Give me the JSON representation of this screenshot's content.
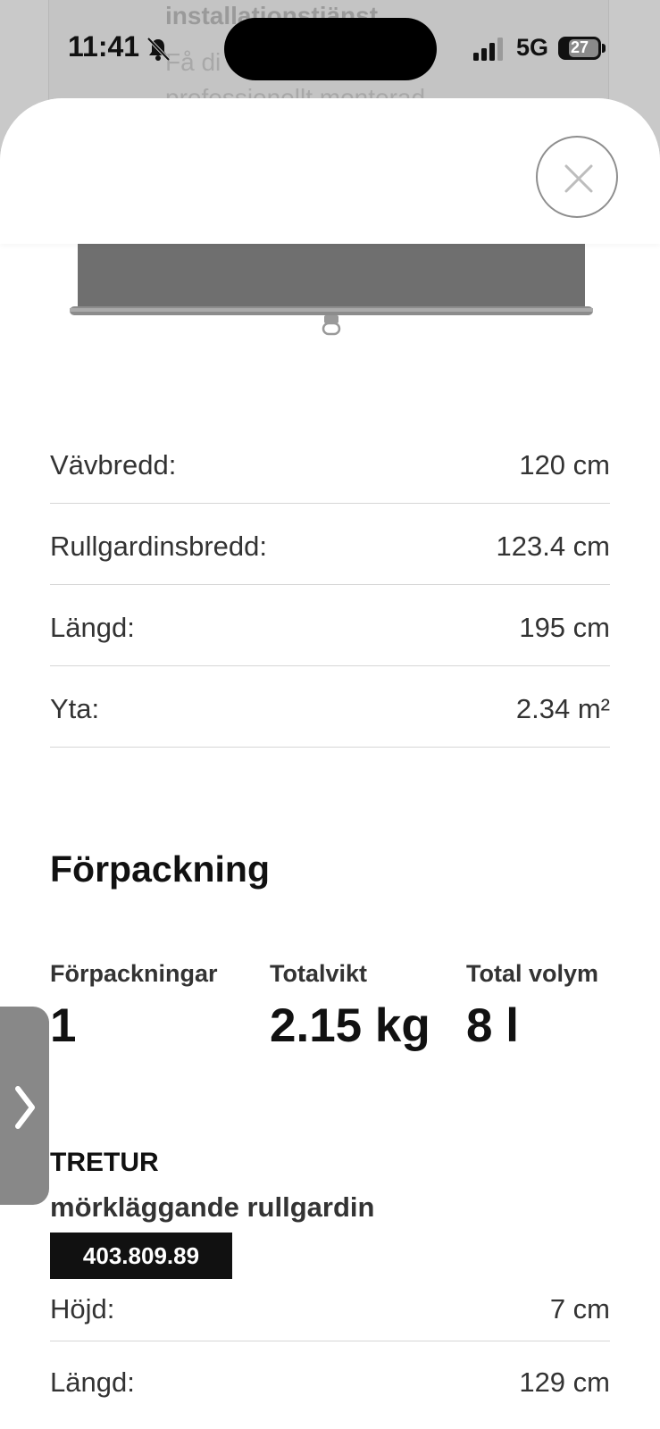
{
  "background_page": {
    "title_fragment": "installationstjänst",
    "line_fragment": "Få di",
    "line2_fragment": "professionellt monterad"
  },
  "status_bar": {
    "time": "11:41",
    "network": "5G",
    "battery": "27",
    "icons": [
      "bell-slash-icon",
      "signal-icon",
      "battery-icon"
    ]
  },
  "sheet": {
    "close_icon": "close-icon",
    "measurements": [
      {
        "label": "Vävbredd:",
        "value": "120 cm"
      },
      {
        "label": "Rullgardinsbredd:",
        "value": "123.4 cm"
      },
      {
        "label": "Längd:",
        "value": "195 cm"
      },
      {
        "label": "Yta:",
        "value": "2.34 m²"
      }
    ],
    "packaging": {
      "title": "Förpackning",
      "packages_label": "Förpackningar",
      "packages_value": "1",
      "weight_label": "Totalvikt",
      "weight_value": "2.15 kg",
      "volume_label": "Total volym",
      "volume_value": "8 l"
    },
    "product": {
      "name": "TRETUR",
      "description": "mörkläggande rullgardin",
      "article_number": "403.809.89",
      "dimensions": [
        {
          "label": "Höjd:",
          "value": "7 cm"
        },
        {
          "label": "Längd:",
          "value": "129 cm"
        }
      ]
    }
  },
  "side_tab": {
    "icon": "chevron-right-icon"
  }
}
